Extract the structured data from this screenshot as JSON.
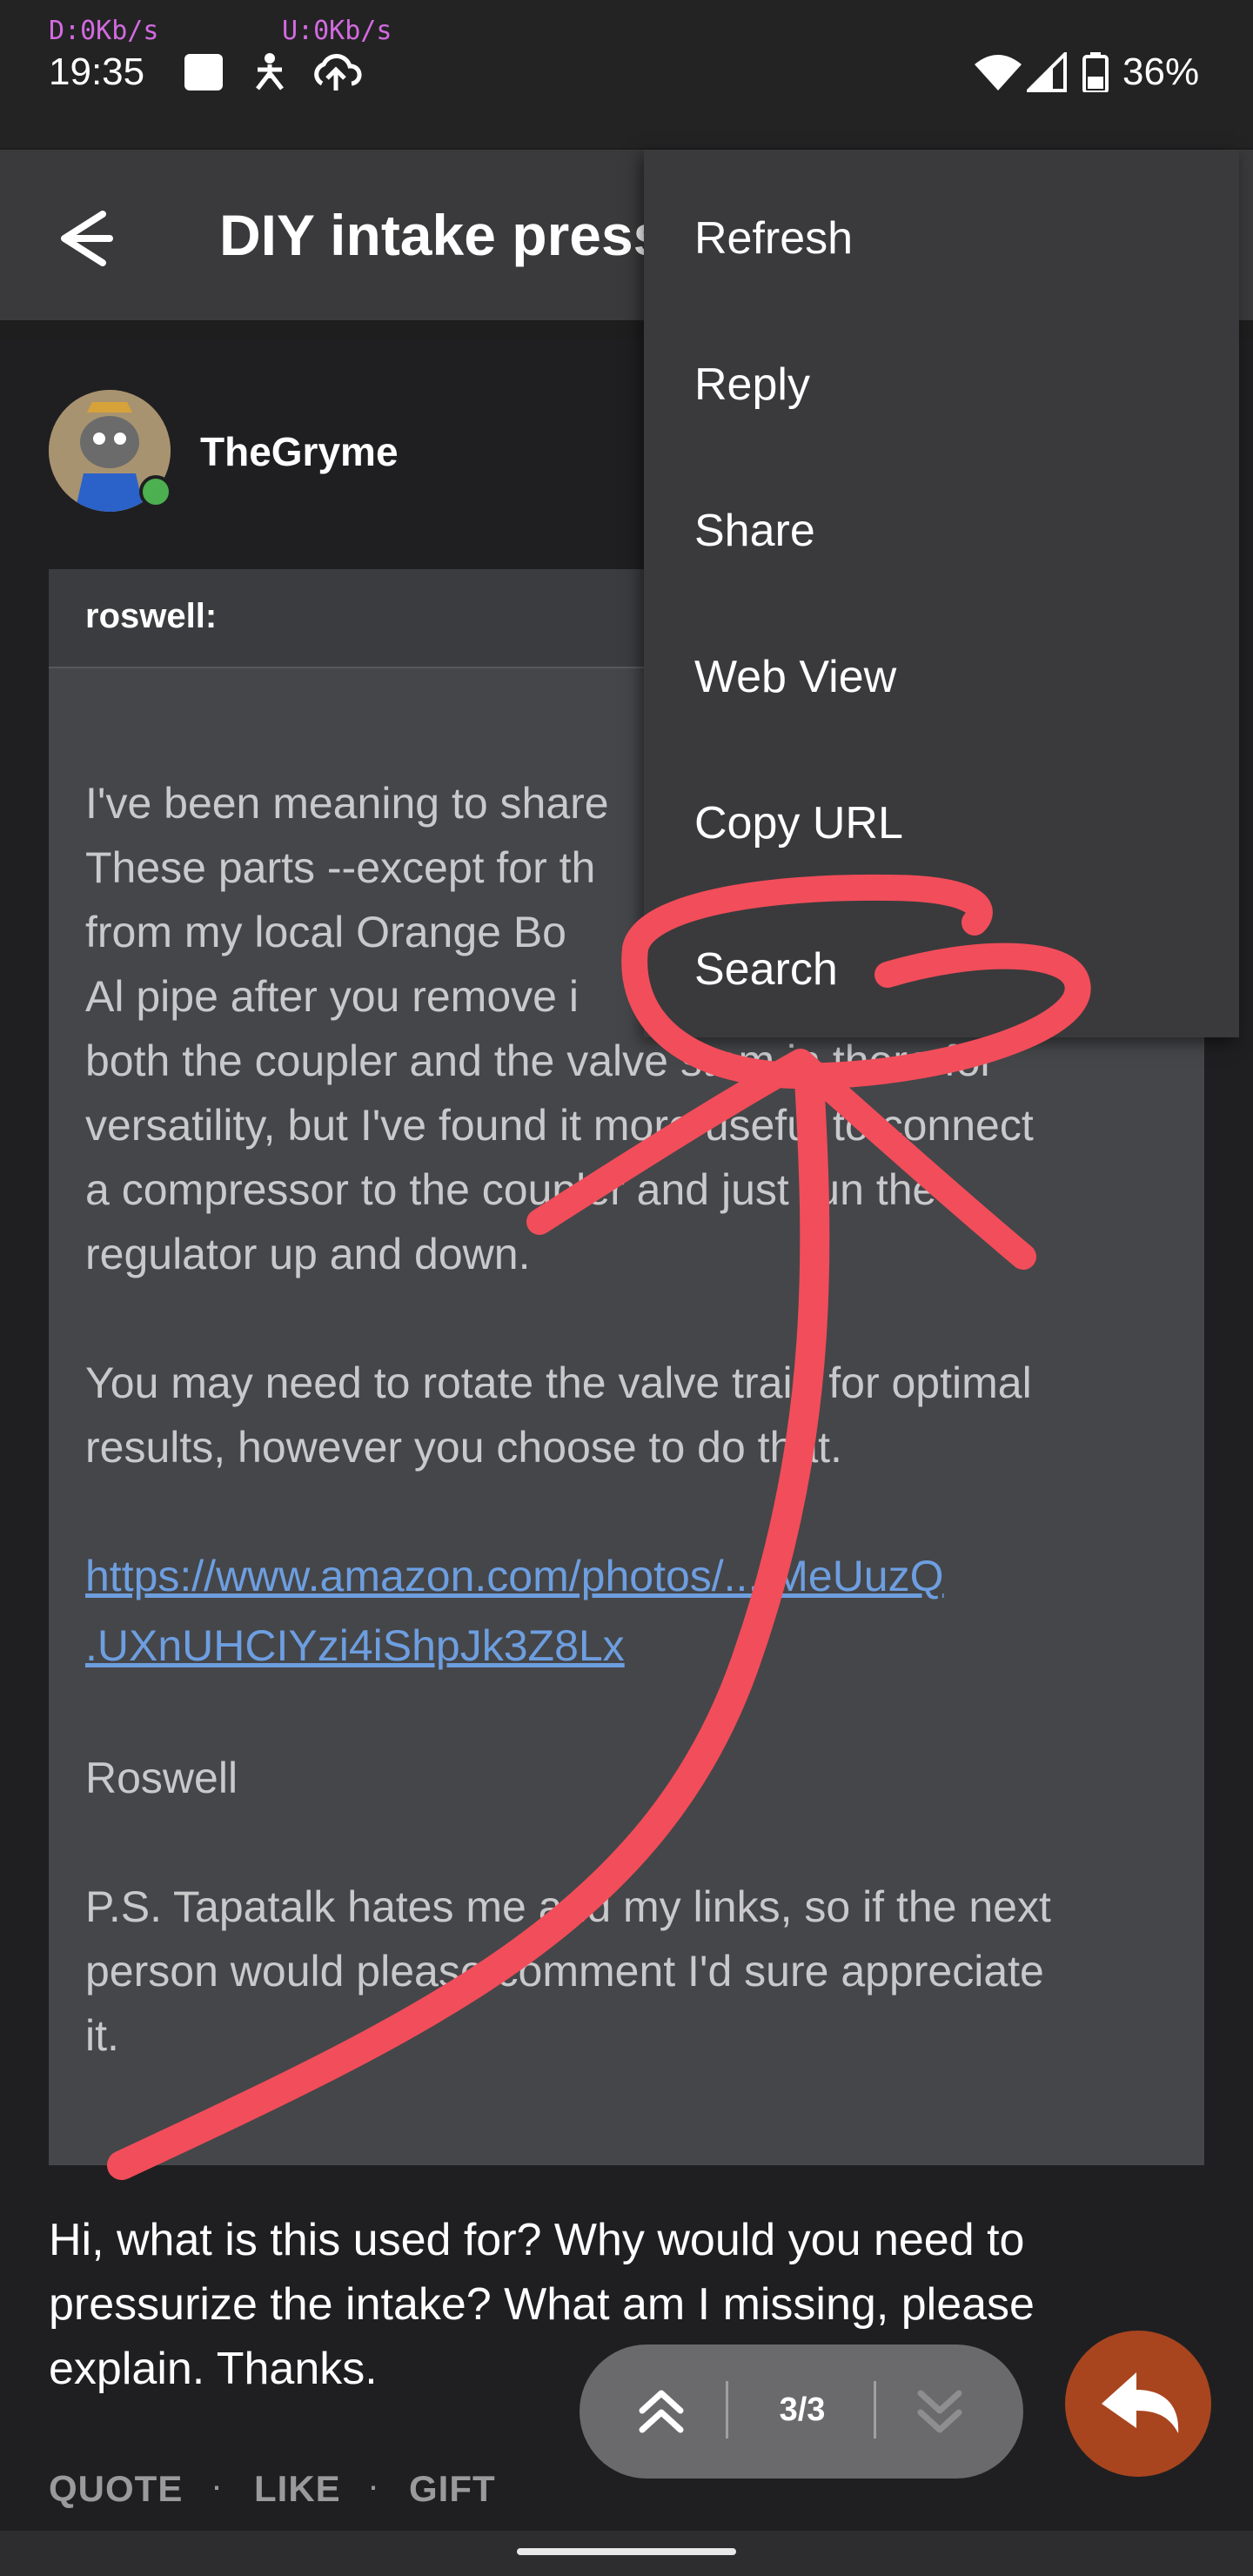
{
  "status_bar": {
    "download_speed": "D:0Kb/s",
    "upload_speed": "U:0Kb/s",
    "time": "19:35",
    "battery": "36%"
  },
  "app_bar": {
    "title": "DIY intake pressure tester"
  },
  "post": {
    "username": "TheGryme",
    "quote": {
      "author": "roswell:",
      "lines": [
        "I've been meaning to share",
        "These parts --except for th",
        "from my local Orange Bo",
        "Al pipe after you remove i",
        "both the coupler and the valve stem in there for",
        "versatility, but I've found it more useful to connect",
        "a compressor to the coupler and just run the",
        "regulator up and down.",
        "You may need to rotate the valve train for optimal",
        "results, however you choose to do that.",
        "Roswell",
        "P.S. Tapatalk hates me and my links, so if the next",
        "person would please comment I'd sure appreciate",
        "it."
      ],
      "link_lines": [
        "https://www.amazon.com/photos/...tMeUuzQ",
        ".UXnUHCIYzi4iShpJk3Z8Lx"
      ]
    },
    "reply_lines": [
      "Hi, what is this used for? Why would you need to",
      "pressurize the intake? What am I missing, please",
      "explain. Thanks."
    ],
    "actions": {
      "quote": "QUOTE",
      "like": "LIKE",
      "gift": "GIFT",
      "separator": "·"
    }
  },
  "pager": {
    "indicator": "3/3"
  },
  "menu": {
    "items": [
      "Refresh",
      "Reply",
      "Share",
      "Web View",
      "Copy URL",
      "Search"
    ]
  },
  "colors": {
    "annotation": "#f24d5a",
    "fab": "#a8451f",
    "link": "#6d9ee0"
  },
  "icons": [
    "back-arrow-icon",
    "wifi-icon",
    "signal-icon",
    "battery-icon",
    "reply-icon",
    "double-chevron-up-icon",
    "double-chevron-down-icon"
  ]
}
